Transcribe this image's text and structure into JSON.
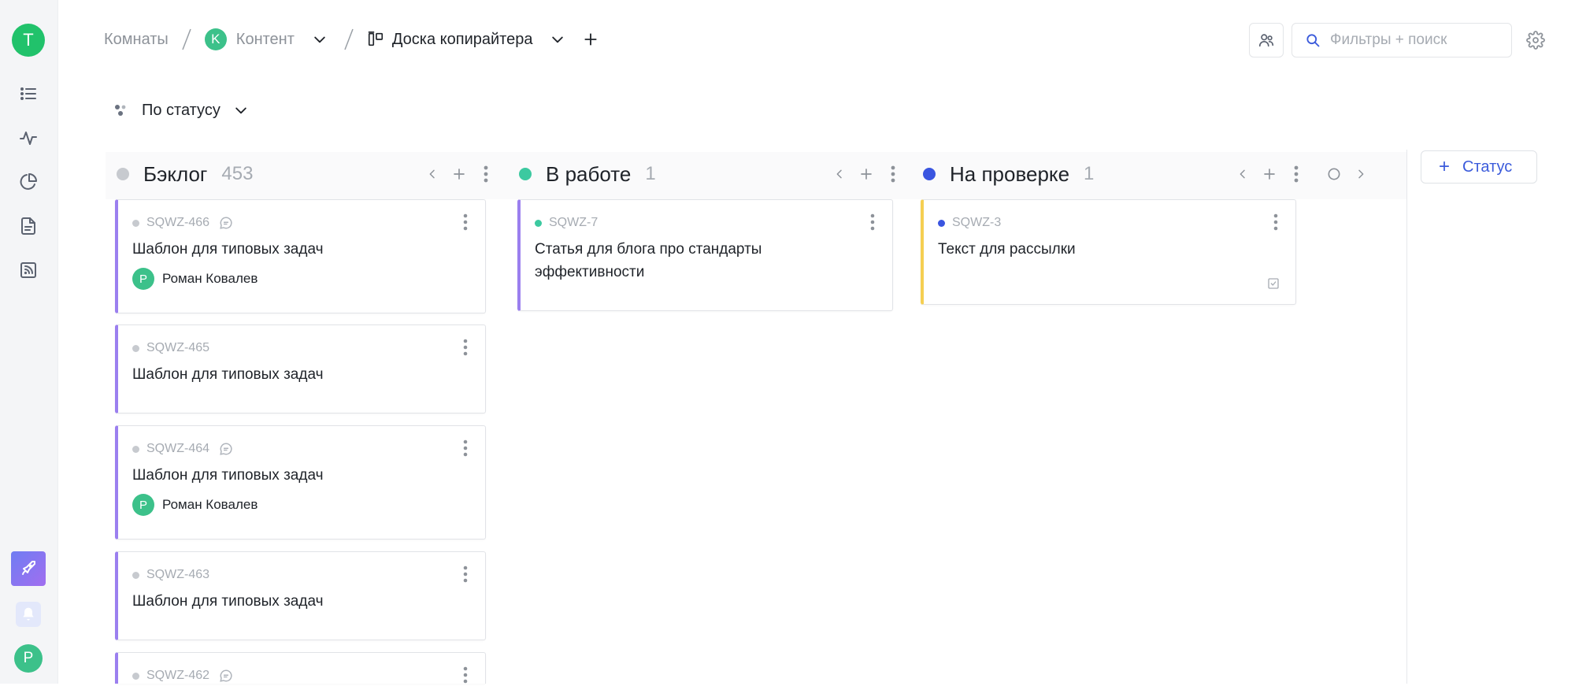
{
  "rail": {
    "workspace_initial": "T",
    "user_initial": "Р",
    "nav": [
      "list-icon",
      "activity-icon",
      "pie-chart-icon",
      "document-icon",
      "rss-icon"
    ]
  },
  "breadcrumbs": {
    "room": "Комнаты",
    "space_initial": "K",
    "space": "Контент",
    "board": "Доска копирайтера"
  },
  "search": {
    "placeholder": "Фильтры + поиск"
  },
  "groupby": {
    "label": "По статусу"
  },
  "columns": [
    {
      "title": "Бэклог",
      "count": "453",
      "color": "#c7cacf",
      "cards": [
        {
          "id": "SQWZ-466",
          "title": "Шаблон для типовых задач",
          "assignee": "Роман Ковалев",
          "assignee_initial": "Р"
        },
        {
          "id": "SQWZ-465",
          "title": "Шаблон для типовых задач"
        },
        {
          "id": "SQWZ-464",
          "title": "Шаблон для типовых задач",
          "assignee": "Роман Ковалев",
          "assignee_initial": "Р"
        },
        {
          "id": "SQWZ-463",
          "title": "Шаблон для типовых задач"
        },
        {
          "id": "SQWZ-462"
        }
      ]
    },
    {
      "title": "В работе",
      "count": "1",
      "color": "#3cc9a0",
      "cards": [
        {
          "id": "SQWZ-7",
          "title": "Статья для блога про стандарты эффективности"
        }
      ]
    },
    {
      "title": "На проверке",
      "count": "1",
      "color": "#3a55e0",
      "cards": [
        {
          "id": "SQWZ-3",
          "title": "Текст для рассылки"
        }
      ]
    }
  ],
  "add_status": {
    "label": "Статус"
  },
  "colors": {
    "accent": "#3b5bdb",
    "card_border_purple": "#9b7fef",
    "card_border_yellow": "#f5cf52"
  }
}
